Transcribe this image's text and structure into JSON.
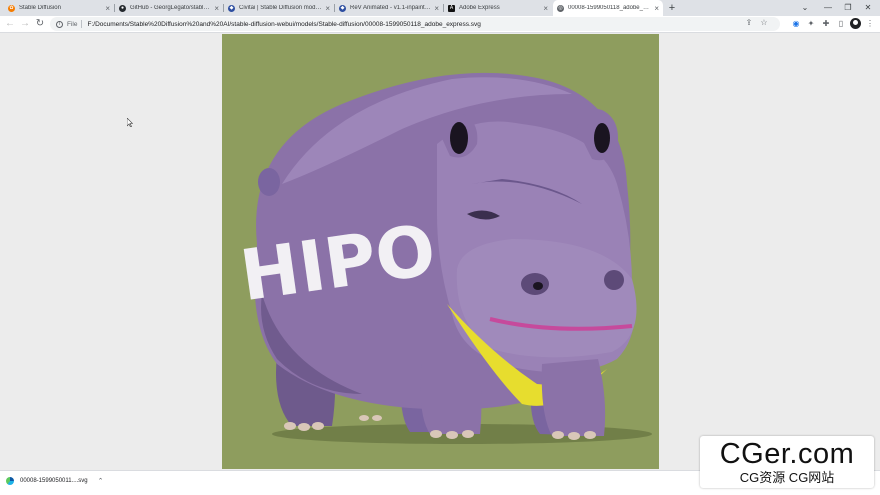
{
  "tabs": [
    {
      "title": "Stable Diffusion",
      "favicon": "stable-diffusion-icon",
      "color": "#f57c00"
    },
    {
      "title": "GitHub - GeorgLegato/stable-dif",
      "favicon": "github-icon",
      "color": "#24292e"
    },
    {
      "title": "Civitai | Stable Diffusion models",
      "favicon": "civitai-icon",
      "color": "#2d4ea0"
    },
    {
      "title": "ReV Animated - v1.1-inpainting",
      "favicon": "civitai-icon",
      "color": "#2d4ea0"
    },
    {
      "title": "Adobe Express",
      "favicon": "adobe-express-icon",
      "color": "#111111"
    },
    {
      "title": "00008-1599050118_adobe_expr",
      "favicon": "globe-icon",
      "color": "#5f6368",
      "active": true
    }
  ],
  "address": {
    "scheme": "File",
    "url": "F:/Documents/Stable%20Diffusion%20and%20AI/stable-diffusion-webui/models/Stable-diffusion/00008-1599050118_adobe_express.svg"
  },
  "image": {
    "text": "HIPO",
    "background": "#8e9d5e",
    "body_color": "#8b72a8"
  },
  "download": {
    "filename": "00008-1599050011....svg"
  },
  "watermark": {
    "title": "CGer.com",
    "subtitle": "CG资源 CG网站"
  }
}
